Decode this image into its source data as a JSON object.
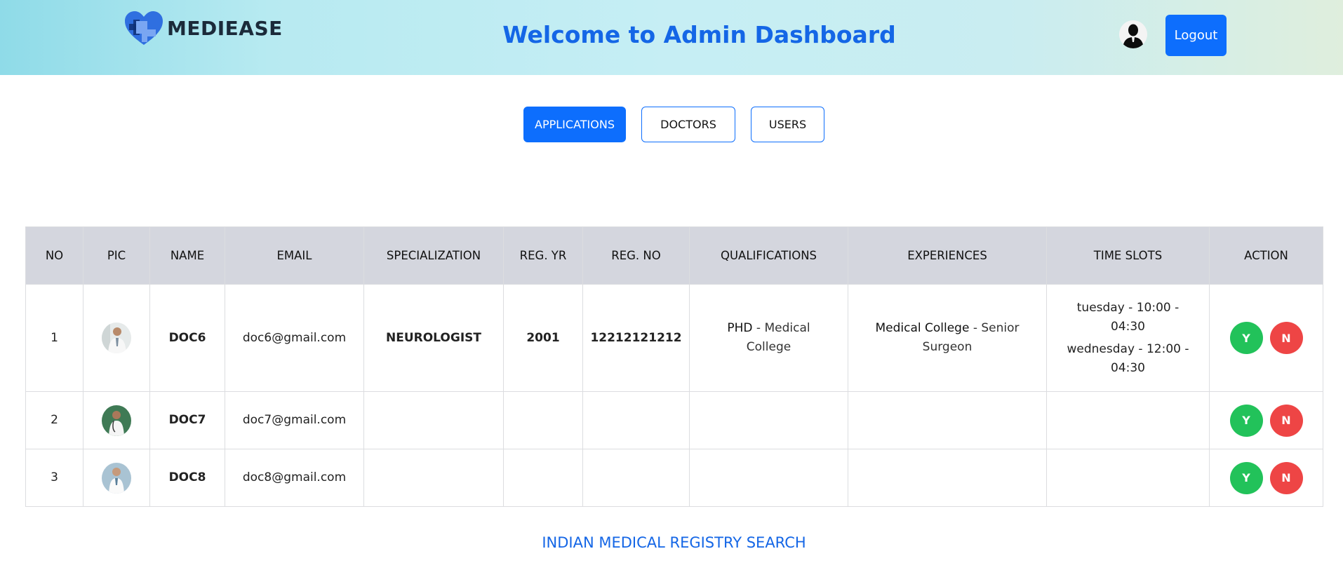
{
  "header": {
    "brand": "MEDIEASE",
    "title": "Welcome to Admin Dashboard",
    "logout_label": "Logout",
    "accent": "#0d6efd"
  },
  "tabs": [
    {
      "label": "APPLICATIONS",
      "active": true
    },
    {
      "label": "DOCTORS",
      "active": false
    },
    {
      "label": "USERS",
      "active": false
    }
  ],
  "table": {
    "columns": [
      "NO",
      "PIC",
      "NAME",
      "EMAIL",
      "SPECIALIZATION",
      "REG. YR",
      "REG. NO",
      "QUALIFICATIONS",
      "EXPERIENCES",
      "TIME SLOTS",
      "ACTION"
    ],
    "rows": [
      {
        "no": "1",
        "name": "DOC6",
        "email": "doc6@gmail.com",
        "specialization": "NEUROLOGIST",
        "reg_yr": "2001",
        "reg_no": "12212121212",
        "qualification_degree": "PHD",
        "qualification_rest": " - Medical College",
        "experience_place": "Medical College",
        "experience_rest": " - Senior Surgeon",
        "slots": [
          "tuesday - 10:00 - 04:30",
          "wednesday - 12:00 - 04:30"
        ]
      },
      {
        "no": "2",
        "name": "DOC7",
        "email": "doc7@gmail.com"
      },
      {
        "no": "3",
        "name": "DOC8",
        "email": "doc8@gmail.com"
      }
    ],
    "action_yes": "Y",
    "action_no": "N"
  },
  "footer": {
    "registry_link": "INDIAN MEDICAL REGISTRY SEARCH"
  }
}
